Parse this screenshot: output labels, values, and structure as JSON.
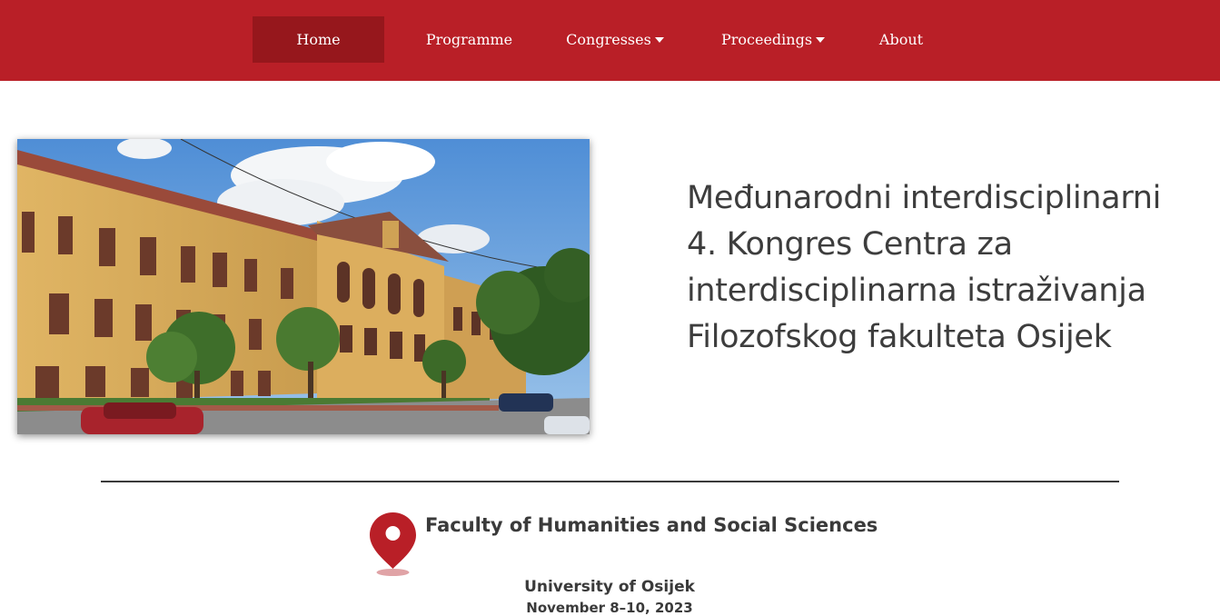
{
  "nav": {
    "items": [
      {
        "label": "Home",
        "active": true,
        "dropdown": false
      },
      {
        "label": "Programme",
        "active": false,
        "dropdown": false
      },
      {
        "label": "Congresses",
        "active": false,
        "dropdown": true
      },
      {
        "label": "Proceedings",
        "active": false,
        "dropdown": true
      },
      {
        "label": "About",
        "active": false,
        "dropdown": false
      }
    ],
    "colors": {
      "bar": "#b91f27",
      "active": "#96171c"
    }
  },
  "hero": {
    "image_icon": "building-photo",
    "title": "Međunarodni interdisciplinarni 4. Kongres Centra za interdisciplinarna istraživanja Filozofskog fakulteta Osijek"
  },
  "venue": {
    "icon": "location-pin-icon",
    "name": "Faculty of Humanities and Social Sciences",
    "university": "University of Osijek",
    "dates": "November 8–10, 2023"
  }
}
